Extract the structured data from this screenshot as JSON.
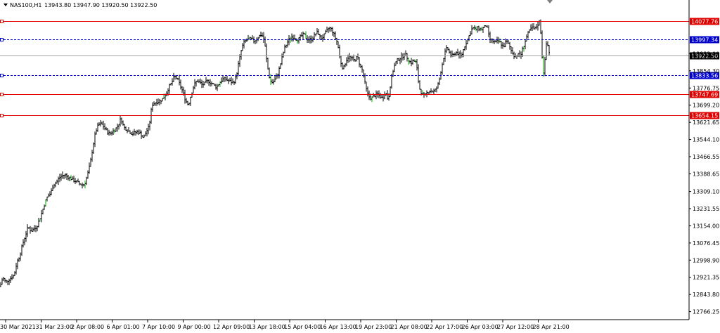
{
  "header": {
    "symbol": "NAS100,H1",
    "ohlc": "13943.80 13947.90 13920.50 13922.50"
  },
  "chart_data": {
    "type": "candlestick",
    "y_ticks": [
      13699.2,
      13621.65,
      13544.1,
      13466.55,
      13388.65,
      13309.1,
      13231.55,
      13154.0,
      13076.45,
      12998.9,
      12921.35,
      12843.8,
      12766.25,
      13776.75,
      13854.3,
      13932.0
    ],
    "y_tick_labels": [
      "13699.20",
      "13621.65",
      "13544.10",
      "13466.55",
      "13388.65",
      "13309.10",
      "13231.55",
      "13154.00",
      "13076.45",
      "12998.90",
      "12921.35",
      "12843.80",
      "12766.25",
      "13776.75",
      "13854.30",
      "13932.00"
    ],
    "ylim": [
      12730,
      14130
    ],
    "x_labels": [
      "30 Mar 2021",
      "31 Mar 23:00",
      "2 Apr 08:00",
      "6 Apr 01:00",
      "7 Apr 10:00",
      "9 Apr 00:00",
      "12 Apr 09:00",
      "13 Apr 18:00",
      "15 Apr 04:00",
      "16 Apr 13:00",
      "19 Apr 23:00",
      "21 Apr 08:00",
      "22 Apr 17:00",
      "26 Apr 03:00",
      "27 Apr 12:00",
      "28 Apr 21:00"
    ],
    "levels": [
      {
        "price": 14077.76,
        "label": "14077.76",
        "style": "solid",
        "color": "#e00000"
      },
      {
        "price": 13997.34,
        "label": "13997.34",
        "style": "dashed",
        "color": "#0000cc"
      },
      {
        "price": 13922.5,
        "label": "13922.50",
        "style": "current",
        "color": "#000000"
      },
      {
        "price": 13833.56,
        "label": "13833.56",
        "style": "dashed",
        "color": "#0000cc"
      },
      {
        "price": 13747.69,
        "label": "13747.69",
        "style": "solid",
        "color": "#e00000"
      },
      {
        "price": 13654.15,
        "label": "13654.15",
        "style": "solid",
        "color": "#e00000"
      }
    ],
    "anchors": [
      [
        0,
        12880
      ],
      [
        4,
        12920
      ],
      [
        8,
        12900
      ],
      [
        12,
        12910
      ],
      [
        16,
        12920
      ],
      [
        20,
        12930
      ],
      [
        24,
        12990
      ],
      [
        28,
        13020
      ],
      [
        32,
        13070
      ],
      [
        36,
        13110
      ],
      [
        40,
        13150
      ],
      [
        44,
        13130
      ],
      [
        48,
        13140
      ],
      [
        52,
        13150
      ],
      [
        56,
        13180
      ],
      [
        60,
        13220
      ],
      [
        64,
        13260
      ],
      [
        68,
        13290
      ],
      [
        72,
        13300
      ],
      [
        76,
        13340
      ],
      [
        80,
        13350
      ],
      [
        84,
        13370
      ],
      [
        88,
        13380
      ],
      [
        92,
        13385
      ],
      [
        96,
        13375
      ],
      [
        100,
        13370
      ],
      [
        104,
        13360
      ],
      [
        108,
        13355
      ],
      [
        112,
        13345
      ],
      [
        116,
        13340
      ],
      [
        120,
        13340
      ],
      [
        124,
        13380
      ],
      [
        128,
        13430
      ],
      [
        132,
        13510
      ],
      [
        136,
        13580
      ],
      [
        140,
        13610
      ],
      [
        144,
        13615
      ],
      [
        148,
        13600
      ],
      [
        152,
        13580
      ],
      [
        156,
        13570
      ],
      [
        160,
        13580
      ],
      [
        164,
        13590
      ],
      [
        168,
        13610
      ],
      [
        172,
        13640
      ],
      [
        176,
        13600
      ],
      [
        180,
        13590
      ],
      [
        184,
        13580
      ],
      [
        188,
        13570
      ],
      [
        192,
        13575
      ],
      [
        196,
        13580
      ],
      [
        200,
        13570
      ],
      [
        204,
        13550
      ],
      [
        208,
        13580
      ],
      [
        212,
        13600
      ],
      [
        216,
        13700
      ],
      [
        220,
        13710
      ],
      [
        224,
        13715
      ],
      [
        228,
        13720
      ],
      [
        232,
        13730
      ],
      [
        236,
        13750
      ],
      [
        240,
        13780
      ],
      [
        244,
        13800
      ],
      [
        248,
        13830
      ],
      [
        252,
        13820
      ],
      [
        256,
        13790
      ],
      [
        260,
        13760
      ],
      [
        264,
        13720
      ],
      [
        268,
        13700
      ],
      [
        272,
        13750
      ],
      [
        276,
        13790
      ],
      [
        280,
        13810
      ],
      [
        284,
        13800
      ],
      [
        288,
        13790
      ],
      [
        292,
        13800
      ],
      [
        296,
        13810
      ],
      [
        300,
        13800
      ],
      [
        304,
        13790
      ],
      [
        308,
        13780
      ],
      [
        312,
        13800
      ],
      [
        316,
        13815
      ],
      [
        320,
        13820
      ],
      [
        324,
        13810
      ],
      [
        328,
        13805
      ],
      [
        332,
        13800
      ],
      [
        336,
        13830
      ],
      [
        340,
        13900
      ],
      [
        344,
        13960
      ],
      [
        348,
        13990
      ],
      [
        352,
        13995
      ],
      [
        356,
        14000
      ],
      [
        360,
        13990
      ],
      [
        364,
        13995
      ],
      [
        368,
        14010
      ],
      [
        372,
        14020
      ],
      [
        376,
        13990
      ],
      [
        380,
        13880
      ],
      [
        384,
        13810
      ],
      [
        388,
        13800
      ],
      [
        392,
        13820
      ],
      [
        396,
        13850
      ],
      [
        400,
        13900
      ],
      [
        404,
        13950
      ],
      [
        408,
        13980
      ],
      [
        412,
        14000
      ],
      [
        416,
        14010
      ],
      [
        420,
        14000
      ],
      [
        424,
        13995
      ],
      [
        428,
        14010
      ],
      [
        432,
        14020
      ],
      [
        436,
        14000
      ],
      [
        440,
        13995
      ],
      [
        444,
        14000
      ],
      [
        448,
        14020
      ],
      [
        452,
        14030
      ],
      [
        456,
        14000
      ],
      [
        460,
        14010
      ],
      [
        464,
        14030
      ],
      [
        468,
        14050
      ],
      [
        472,
        14040
      ],
      [
        476,
        14010
      ],
      [
        480,
        13980
      ],
      [
        484,
        13900
      ],
      [
        488,
        13860
      ],
      [
        492,
        13900
      ],
      [
        496,
        13920
      ],
      [
        500,
        13910
      ],
      [
        504,
        13900
      ],
      [
        508,
        13920
      ],
      [
        512,
        13880
      ],
      [
        516,
        13850
      ],
      [
        520,
        13780
      ],
      [
        524,
        13740
      ],
      [
        528,
        13730
      ],
      [
        532,
        13740
      ],
      [
        536,
        13750
      ],
      [
        540,
        13740
      ],
      [
        544,
        13730
      ],
      [
        548,
        13760
      ],
      [
        552,
        13720
      ],
      [
        556,
        13810
      ],
      [
        560,
        13870
      ],
      [
        564,
        13900
      ],
      [
        568,
        13910
      ],
      [
        572,
        13920
      ],
      [
        576,
        13930
      ],
      [
        580,
        13910
      ],
      [
        584,
        13890
      ],
      [
        588,
        13900
      ],
      [
        592,
        13890
      ],
      [
        596,
        13780
      ],
      [
        600,
        13750
      ],
      [
        604,
        13740
      ],
      [
        608,
        13760
      ],
      [
        612,
        13765
      ],
      [
        616,
        13760
      ],
      [
        620,
        13770
      ],
      [
        624,
        13800
      ],
      [
        628,
        13870
      ],
      [
        632,
        13930
      ],
      [
        636,
        13960
      ],
      [
        640,
        13930
      ],
      [
        644,
        13920
      ],
      [
        648,
        13940
      ],
      [
        652,
        13930
      ],
      [
        656,
        13920
      ],
      [
        660,
        13960
      ],
      [
        664,
        13990
      ],
      [
        668,
        14020
      ],
      [
        672,
        14050
      ],
      [
        676,
        14040
      ],
      [
        680,
        14050
      ],
      [
        684,
        14040
      ],
      [
        688,
        14050
      ],
      [
        692,
        14060
      ],
      [
        696,
        14000
      ],
      [
        700,
        13990
      ],
      [
        704,
        13980
      ],
      [
        708,
        13990
      ],
      [
        712,
        13980
      ],
      [
        716,
        13960
      ],
      [
        720,
        13990
      ],
      [
        724,
        13970
      ],
      [
        728,
        13940
      ],
      [
        732,
        13920
      ],
      [
        736,
        13930
      ],
      [
        740,
        13920
      ],
      [
        744,
        13960
      ],
      [
        748,
        14000
      ],
      [
        752,
        14030
      ],
      [
        756,
        14050
      ],
      [
        760,
        14040
      ],
      [
        764,
        14060
      ],
      [
        768,
        14080
      ],
      [
        770,
        13980
      ],
      [
        772,
        13860
      ],
      [
        774,
        13840
      ],
      [
        776,
        13960
      ],
      [
        778,
        13990
      ],
      [
        780,
        13950
      ],
      [
        782,
        13930
      ]
    ]
  },
  "colors": {
    "candle": "#000000",
    "grid_line": "#000000",
    "support": "#e00000",
    "pivot": "#0000cc",
    "bull_tick": "#00aa00"
  }
}
